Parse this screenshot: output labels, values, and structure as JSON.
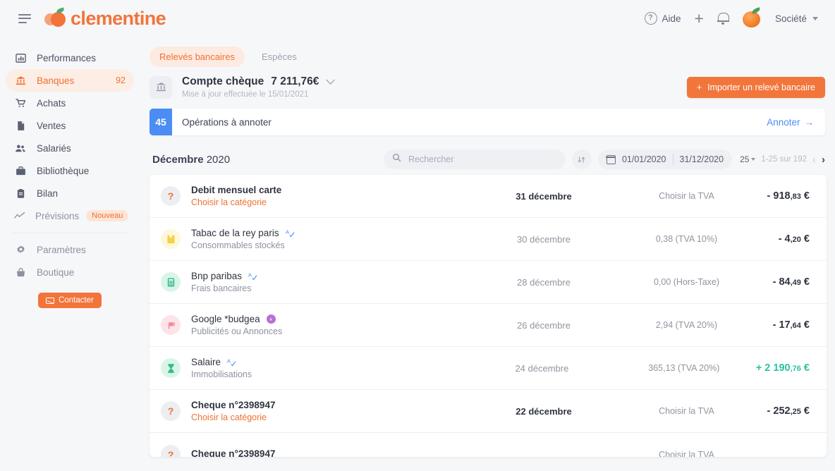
{
  "brand": {
    "name": "clementine"
  },
  "header": {
    "menu_icon": "hamburger-icon",
    "help_label": "Aide",
    "add_label": "+",
    "notifications_icon": "bell-icon",
    "company_label": "Société"
  },
  "sidebar": {
    "items": [
      {
        "label": "Performances",
        "icon": "chart-bar-icon",
        "state": "normal"
      },
      {
        "label": "Banques",
        "icon": "bank-icon",
        "state": "active",
        "count": "92"
      },
      {
        "label": "Achats",
        "icon": "cart-icon",
        "state": "normal"
      },
      {
        "label": "Ventes",
        "icon": "document-icon",
        "state": "normal"
      },
      {
        "label": "Salariés",
        "icon": "users-icon",
        "state": "normal"
      },
      {
        "label": "Bibliothèque",
        "icon": "briefcase-icon",
        "state": "normal"
      },
      {
        "label": "Bilan",
        "icon": "clipboard-icon",
        "state": "normal"
      },
      {
        "label": "Prévisions",
        "icon": "trend-line-icon",
        "state": "muted",
        "badge": "Nouveau"
      },
      {
        "label": "Paramètres",
        "icon": "gear-icon",
        "state": "muted"
      },
      {
        "label": "Boutique",
        "icon": "shopping-bag-icon",
        "state": "muted"
      }
    ],
    "contact_label": "Contacter"
  },
  "main": {
    "tabs": [
      {
        "label": "Relevés bancaires",
        "active": true
      },
      {
        "label": "Espèces",
        "active": false
      }
    ],
    "account": {
      "icon": "bank-icon",
      "name": "Compte chèque",
      "balance": "7 211,76€",
      "updated": "Mise à jour effectuée le 15/01/2021",
      "import_label": "Importer un relevé bancaire"
    },
    "annotate": {
      "count": "45",
      "label": "Opérations à annoter",
      "action": "Annoter"
    },
    "toolbar": {
      "period_month": "Décembre",
      "period_year": "2020",
      "search_placeholder": "Rechercher",
      "search_value": "",
      "sort_icon": "sort-arrows-icon",
      "calendar_icon": "calendar-icon",
      "date_from": "01/01/2020",
      "date_to": "31/12/2020",
      "per_page": "25",
      "range": "1-25 sur 192"
    },
    "rows": [
      {
        "icon": "question-mark-icon",
        "icon_bg": "#eceef1",
        "icon_fg": "#ef7133",
        "glyph": "?",
        "title": "Debit mensuel carte",
        "title_bold": true,
        "subtitle": "Choisir la catégorie",
        "subtitle_todo": true,
        "badge": "none",
        "date": "31 décembre",
        "date_bold": true,
        "tva": "Choisir la TVA",
        "amount_main": "- 918",
        "amount_dec": ",83",
        "amount_cur": " €",
        "positive": false
      },
      {
        "icon": "yellow-book-icon",
        "icon_bg": "#fdf6d9",
        "icon_fg": "#f2cc3e",
        "glyph": "▯",
        "title": "Tabac de la rey paris",
        "title_bold": false,
        "subtitle": "Consommables stockés",
        "subtitle_todo": false,
        "badge": "auto",
        "date": "30 décembre",
        "date_bold": false,
        "tva": "0,38 (TVA 10%)",
        "amount_main": "- 4",
        "amount_dec": ",20",
        "amount_cur": " €",
        "positive": false
      },
      {
        "icon": "calculator-icon",
        "icon_bg": "#ddf6ea",
        "icon_fg": "#35b98a",
        "glyph": "▦",
        "title": "Bnp paribas",
        "title_bold": false,
        "subtitle": "Frais bancaires",
        "subtitle_todo": false,
        "badge": "auto",
        "date": "28 décembre",
        "date_bold": false,
        "tva": "0,00 (Hors-Taxe)",
        "amount_main": "- 84",
        "amount_dec": ",49",
        "amount_cur": " €",
        "positive": false
      },
      {
        "icon": "megaphone-icon",
        "icon_bg": "#fde6e9",
        "icon_fg": "#f4909f",
        "glyph": "◥",
        "title": "Google *budgea",
        "title_bold": false,
        "subtitle": "Publicités ou Annonces",
        "subtitle_todo": false,
        "badge": "purple",
        "date": "26 décembre",
        "date_bold": false,
        "tva": "2,94 (TVA 20%)",
        "amount_main": "- 17",
        "amount_dec": ",64",
        "amount_cur": " €",
        "positive": false
      },
      {
        "icon": "hourglass-icon",
        "icon_bg": "#ddf6ea",
        "icon_fg": "#35b98a",
        "glyph": "⧗",
        "title": "Salaire",
        "title_bold": false,
        "subtitle": "Immobilisations",
        "subtitle_todo": false,
        "badge": "auto",
        "date": "24 décembre",
        "date_bold": false,
        "tva": "365,13 (TVA 20%)",
        "amount_main": "+ 2 190",
        "amount_dec": ",76",
        "amount_cur": " €",
        "positive": true
      },
      {
        "icon": "question-mark-icon",
        "icon_bg": "#eceef1",
        "icon_fg": "#ef7133",
        "glyph": "?",
        "title": "Cheque n°2398947",
        "title_bold": true,
        "subtitle": "Choisir la catégorie",
        "subtitle_todo": true,
        "badge": "none",
        "date": "22 décembre",
        "date_bold": true,
        "tva": "Choisir la TVA",
        "amount_main": "- 252",
        "amount_dec": ",25",
        "amount_cur": " €",
        "positive": false
      },
      {
        "icon": "question-mark-icon",
        "icon_bg": "#eceef1",
        "icon_fg": "#ef7133",
        "glyph": "?",
        "title": "Cheque n°2398947",
        "title_bold": true,
        "subtitle": "",
        "subtitle_todo": true,
        "badge": "none",
        "date": "",
        "date_bold": true,
        "tva": "Choisir la TVA",
        "amount_main": "",
        "amount_dec": "",
        "amount_cur": "",
        "positive": false
      }
    ]
  },
  "colors": {
    "accent": "#f2743a",
    "accent_soft": "#fdeee5",
    "blue": "#4a8df3",
    "green": "#2bc2a0",
    "page_bg": "#f6f7f9"
  }
}
